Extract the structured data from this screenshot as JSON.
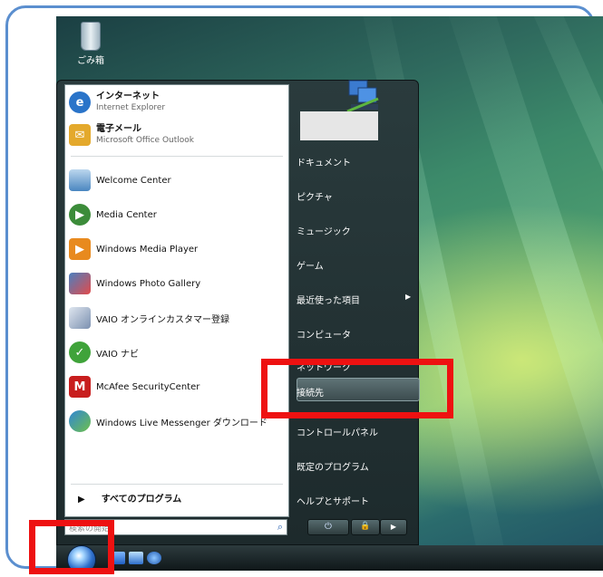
{
  "desktop": {
    "recycle_bin_label": "ごみ箱"
  },
  "start_menu": {
    "pinned": [
      {
        "title": "インターネット",
        "subtitle": "Internet Explorer",
        "icon": "internet-explorer-icon",
        "color": "#2a74c9"
      },
      {
        "title": "電子メール",
        "subtitle": "Microsoft Office Outlook",
        "icon": "outlook-mail-icon",
        "color": "#e4a92c"
      }
    ],
    "recent": [
      {
        "label": "Welcome Center",
        "icon": "welcome-center-icon",
        "color": "#6ea2cf"
      },
      {
        "label": "Media Center",
        "icon": "media-center-icon",
        "color": "#3c8c3a"
      },
      {
        "label": "Windows Media Player",
        "icon": "media-player-icon",
        "color": "#e88a1e"
      },
      {
        "label": "Windows Photo Gallery",
        "icon": "photo-gallery-icon",
        "color": "#4a7fc0"
      },
      {
        "label": "VAIO オンラインカスタマー登録",
        "icon": "vaio-registration-icon",
        "color": "#7b90b0"
      },
      {
        "label": "VAIO ナビ",
        "icon": "vaio-navi-icon",
        "color": "#3fa33a"
      },
      {
        "label": "McAfee SecurityCenter",
        "icon": "mcafee-icon",
        "color": "#c81e1e"
      },
      {
        "label": "Windows Live Messenger ダウンロード",
        "icon": "messenger-icon",
        "color": "#2f86d6"
      }
    ],
    "all_programs": "すべてのプログラム",
    "search_placeholder": "検索の開始",
    "right": [
      "ドキュメント",
      "ピクチャ",
      "ミュージック",
      "ゲーム",
      "最近使った項目",
      "コンピュータ",
      "ネットワーク",
      "接続先",
      "コントロールパネル",
      "既定のプログラム",
      "ヘルプとサポート"
    ],
    "power_glyph": "⏻",
    "lock_glyph": "🔒",
    "arrow_glyph": "▶"
  },
  "highlight_color": "#ee1111"
}
